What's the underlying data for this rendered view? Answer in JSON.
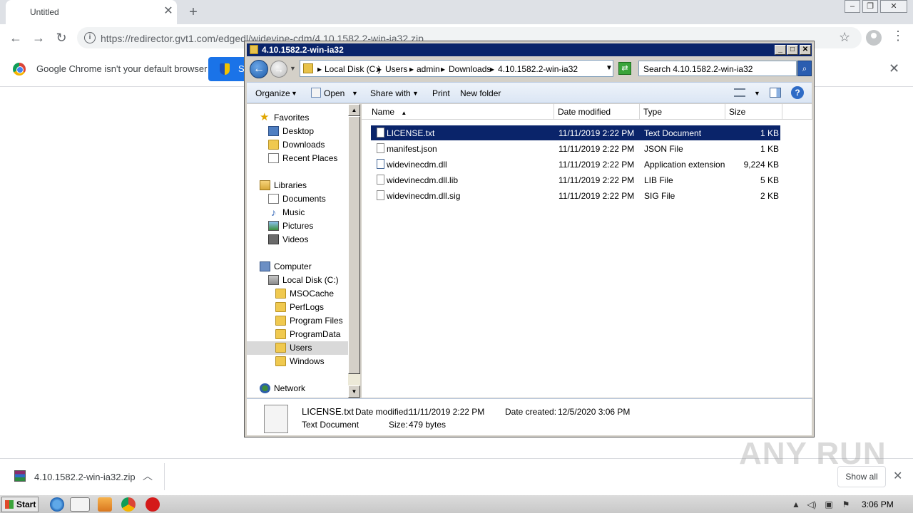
{
  "browser": {
    "tab_title": "Untitled",
    "url": "https://redirector.gvt1.com/edgedl/widevine-cdm/4.10.1582.2-win-ia32.zip",
    "infobar_text": "Google Chrome isn't your default browser",
    "infobar_button_label": "S",
    "download_filename": "4.10.1582.2-win-ia32.zip",
    "show_all_label": "Show all",
    "watermark": "ANY RUN"
  },
  "explorer": {
    "title": "4.10.1582.2-win-ia32",
    "breadcrumbs": [
      "Local Disk (C:)",
      "Users",
      "admin",
      "Downloads",
      "4.10.1582.2-win-ia32"
    ],
    "search_placeholder": "Search 4.10.1582.2-win-ia32",
    "commands": {
      "organize": "Organize",
      "open": "Open",
      "share_with": "Share with",
      "print": "Print",
      "new_folder": "New folder"
    },
    "nav": {
      "favorites": "Favorites",
      "desktop": "Desktop",
      "downloads": "Downloads",
      "recent_places": "Recent Places",
      "libraries": "Libraries",
      "documents": "Documents",
      "music": "Music",
      "pictures": "Pictures",
      "videos": "Videos",
      "computer": "Computer",
      "local_disk": "Local Disk (C:)",
      "msocache": "MSOCache",
      "perflogs": "PerfLogs",
      "program_files": "Program Files",
      "programdata": "ProgramData",
      "users": "Users",
      "windows": "Windows",
      "network": "Network"
    },
    "columns": {
      "name": "Name",
      "date_modified": "Date modified",
      "type": "Type",
      "size": "Size"
    },
    "files": [
      {
        "name": "LICENSE.txt",
        "date": "11/11/2019 2:22 PM",
        "type": "Text Document",
        "size": "1 KB"
      },
      {
        "name": "manifest.json",
        "date": "11/11/2019 2:22 PM",
        "type": "JSON File",
        "size": "1 KB"
      },
      {
        "name": "widevinecdm.dll",
        "date": "11/11/2019 2:22 PM",
        "type": "Application extension",
        "size": "9,224 KB"
      },
      {
        "name": "widevinecdm.dll.lib",
        "date": "11/11/2019 2:22 PM",
        "type": "LIB File",
        "size": "5 KB"
      },
      {
        "name": "widevinecdm.dll.sig",
        "date": "11/11/2019 2:22 PM",
        "type": "SIG File",
        "size": "2 KB"
      }
    ],
    "details": {
      "name": "LICENSE.txt",
      "type": "Text Document",
      "date_modified_label": "Date modified:",
      "date_modified": "11/11/2019 2:22 PM",
      "date_created_label": "Date created:",
      "date_created": "12/5/2020 3:06 PM",
      "size_label": "Size:",
      "size": "479 bytes"
    }
  },
  "taskbar": {
    "start_label": "Start",
    "clock": "3:06 PM"
  }
}
